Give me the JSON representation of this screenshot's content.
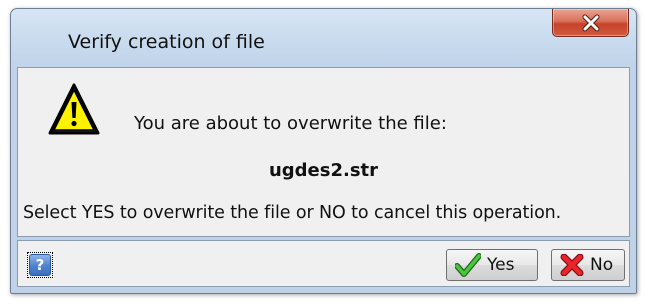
{
  "window": {
    "title": "Verify creation of file",
    "close_icon": "close-icon"
  },
  "message": {
    "icon": "warning-icon",
    "line": "You are about to overwrite the file:",
    "filename": "ugdes2.str",
    "instruction": "Select YES to overwrite the file or NO to cancel this operation."
  },
  "footer": {
    "help_label": "?",
    "help_icon": "help-icon",
    "yes_label": "Yes",
    "yes_icon": "checkmark-icon",
    "no_label": "No",
    "no_icon": "x-mark-icon"
  },
  "colors": {
    "title_bar": "#c9dbee",
    "close_button": "#c7432a",
    "content_bg": "#f0f0f0",
    "warning_yellow": "#fff200",
    "check_green": "#3aa534",
    "x_red": "#e0242a"
  }
}
